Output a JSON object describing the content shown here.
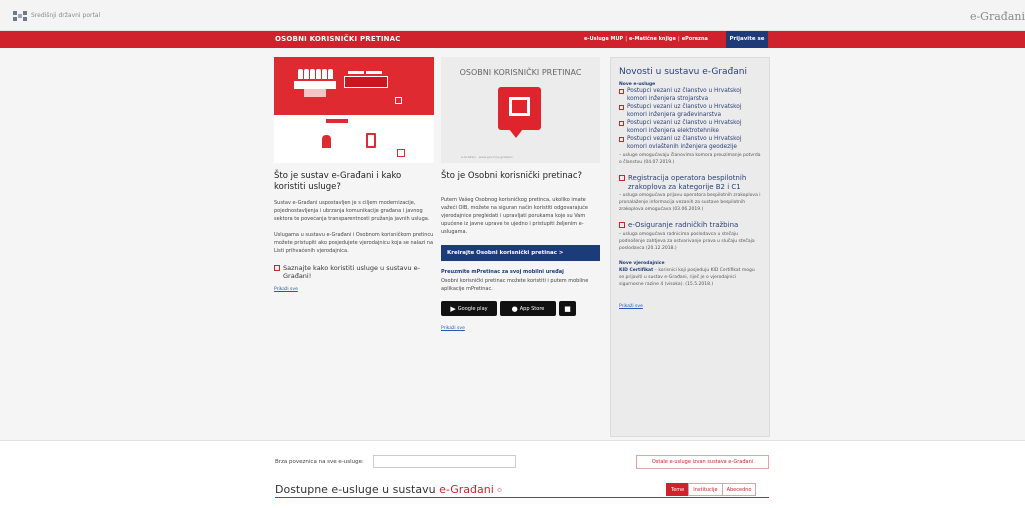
{
  "topbar": {
    "portal_name": "Središnji državni portal",
    "brand": "e-Građani"
  },
  "nav": {
    "title": "OSOBNI KORISNIČKI PRETINAC",
    "links": [
      "e-Usluge MUP",
      "e-Matične knjige",
      "ePorezna"
    ],
    "login_label": "Prijavite se"
  },
  "col1": {
    "heading": "Što je sustav e-Građani i kako koristiti usluge?",
    "p1": "Sustav e-Građani uspostavljen je s ciljem modernizacije, pojednostavljenja i ubrzanja komunikacije građana i javnog sektora te povećanja transparentnosti pružanja javnih usluga.",
    "p2": "Uslugama u sustavu e-Građani i Osobnom korisničkom pretincu možete pristupiti ako posjedujete vjerodajnicu koja se nalazi na Listi prihvaćenih vjerodajnica.",
    "link": "Saznajte kako koristiti usluge u sustavu e-Građani!",
    "more": "Prikaži sve"
  },
  "col2": {
    "hero_title": "OSOBNI KORISNIČKI PRETINAC",
    "hero_footer": "e-Građani · www.gov.hr/e-gradjani",
    "heading": "Što je Osobni korisnički pretinac?",
    "p1": "Putem Vašeg Osobnog korisničkog pretinca, ukoliko imate važeći OIB, možete na siguran način koristiti odgovarajuće vjerodajnice pregledati i upravljati porukama koje su Vam upućene iz javne uprave te ujedno i pristupiti željenim e-uslugama.",
    "button": "Kreirajte Osobni korisnički pretinac >",
    "app_heading": "Preuzmite mPretinac za svoj mobilni uređaj",
    "app_text": "Osobni korisnički pretinac možete koristiti i putem mobilne aplikacije mPretinac.",
    "stores": {
      "google": "Google play",
      "apple": "App Store"
    },
    "more": "Prikaži sve"
  },
  "col3": {
    "title": "Novosti u sustavu e-Građani",
    "section1": "Nove e-usluge",
    "items": [
      "Postupci vezani uz članstvo u Hrvatskoj komori inženjera strojarstva",
      "Postupci vezani uz članstvo u Hrvatskoj komori inženjera građevinarstva",
      "Postupci vezani uz članstvo u Hrvatskoj komori inženjera elektrotehnike",
      "Postupci vezani uz članstvo u Hrvatskoj komori ovlaštenih inženjera geodezije"
    ],
    "items_desc": "– usluge omogućavaju članovima komora preuzimanje potvrda o članstvu (04.07.2019.)",
    "big1": "Registracija operatora bespilotnih zrakoplova za kategorije B2 i C1",
    "big1_desc": "– usluga omogućava prijavu operatora bespilotnih zrakoplova i pronalaženje informacija vezanih za sustave bespilotnih zrakoplova omogućava (03.06.2019.)",
    "big2": "e-Osiguranje radničkih tražbina",
    "big2_desc": "– usluga omogućava radnicima poslodavca u stečaju podnošenje zahtjeva za ostvarivanje prava u slučaju stečaja poslodavca (20.12.2018.)",
    "section2": "Nove vjerodajnice",
    "cred_name": "KID Certifikat",
    "cred_desc": " – korisnici koji posjeduju KID Certifikat mogu se prijaviti u sustav e-Građani, riječ je o vjerodajnici sigurnosne razine 4 (visoka). (15.5.2018.)",
    "more": "Prikaži sve"
  },
  "bottom": {
    "quick_label": "Brza poveznica na sve e-usluge:",
    "quick_value": "",
    "other_button": "Ostale e-usluge izvan sustava e-Građani",
    "avail_prefix": "Dostupne e-usluge u sustavu ",
    "avail_accent": "e-Građani",
    "tabs": [
      "Teme",
      "Institucije",
      "Abecedno"
    ]
  },
  "colors": {
    "brand_red": "#d0222c",
    "navy": "#1c3b79"
  }
}
